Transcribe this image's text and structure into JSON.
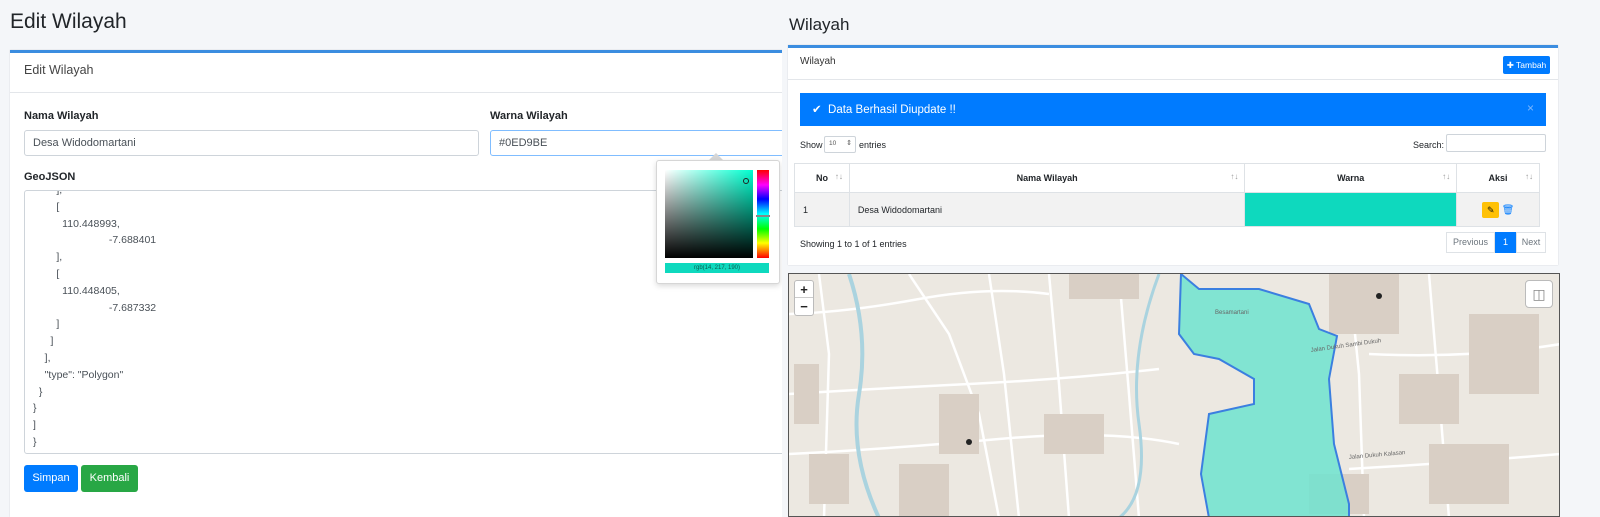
{
  "left": {
    "title": "Edit Wilayah",
    "card_title": "Edit Wilayah",
    "nama_label": "Nama Wilayah",
    "nama_value": "Desa Widodomartani",
    "warna_label": "Warna Wilayah",
    "warna_value": "#0ED9BE",
    "geojson_label": "GeoJSON",
    "geojson_text": "        ],\n        [\n          110.448993,\n                          -7.688401\n        ],\n        [\n          110.448405,\n                          -7.687332\n        ]\n      ]\n    ],\n    \"type\": \"Polygon\"\n  }\n}\n]\n}",
    "picker_value": "rgb(14, 217, 190)",
    "save_label": "Simpan",
    "back_label": "Kembali",
    "accent_color": "#0ed9be"
  },
  "right": {
    "title": "Wilayah",
    "card_title": "Wilayah",
    "add_label": "Tambah",
    "alert_text": "Data Berhasil Diupdate !!",
    "alert_close": "×",
    "show_label": "Show",
    "entries_value": "10",
    "entries_label": "entries",
    "search_label": "Search:",
    "table": {
      "headers": [
        "No",
        "Nama Wilayah",
        "Warna",
        "Aksi"
      ],
      "rows": [
        {
          "no": "1",
          "nama": "Desa Widodomartani",
          "warna": "#0ed9be"
        }
      ]
    },
    "info_text": "Showing 1 to 1 of 1 entries",
    "pager": {
      "previous": "Previous",
      "page": "1",
      "next": "Next"
    },
    "map": {
      "zoom_in": "+",
      "zoom_out": "−",
      "road_label_1": "Jalan Dukuh Sambi Dukuh",
      "road_label_2": "Jalan Dukuh Kalasan",
      "area_label": "Besamartani",
      "polygon_color": "#6fe3cf"
    }
  }
}
